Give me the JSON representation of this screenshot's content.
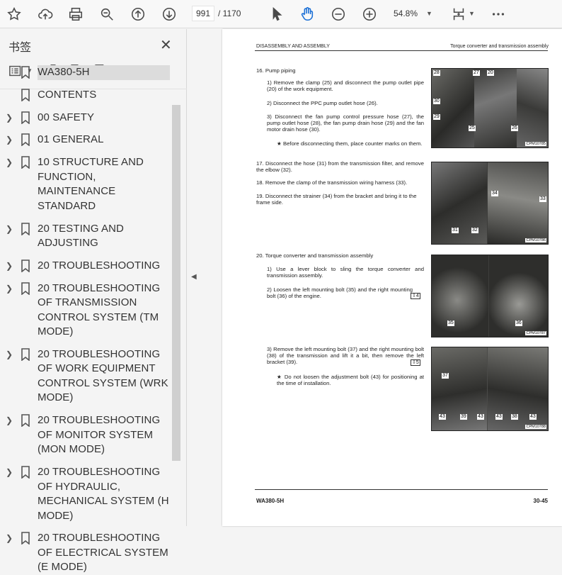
{
  "toolbar": {
    "page_current": "991",
    "page_total": "/ 1170",
    "zoom": "54.8%"
  },
  "sidebar": {
    "title": "书签",
    "items": [
      {
        "label": "WA380-5H",
        "expandable": false,
        "selected": true
      },
      {
        "label": "CONTENTS",
        "expandable": false
      },
      {
        "label": "00 SAFETY",
        "expandable": true
      },
      {
        "label": "01 GENERAL",
        "expandable": true
      },
      {
        "label": "10 STRUCTURE AND FUNCTION, MAINTENANCE STANDARD",
        "expandable": true
      },
      {
        "label": "20 TESTING AND ADJUSTING",
        "expandable": true
      },
      {
        "label": "20 TROUBLESHOOTING",
        "expandable": true
      },
      {
        "label": "20 TROUBLESHOOTING OF TRANSMISSION CONTROL SYSTEM (TM MODE)",
        "expandable": true
      },
      {
        "label": "20 TROUBLESHOOTING OF WORK EQUIPMENT CONTROL SYSTEM (WRK MODE)",
        "expandable": true
      },
      {
        "label": "20 TROUBLESHOOTING OF MONITOR SYSTEM (MON MODE)",
        "expandable": true
      },
      {
        "label": "20 TROUBLESHOOTING OF HYDRAULIC, MECHANICAL SYSTEM (H MODE)",
        "expandable": true
      },
      {
        "label": "20 TROUBLESHOOTING OF ELECTRICAL SYSTEM (E MODE)",
        "expandable": true
      }
    ]
  },
  "doc": {
    "header_left": "DISASSEMBLY AND ASSEMBLY",
    "header_right": "Torque converter and transmission assembly",
    "footer_left": "WA380-5H",
    "footer_right": "30-45",
    "s16": "16. Pump piping",
    "s16_1": "1)   Remove the clamp (25) and disconnect the pump outlet pipe (20) of the work equipment.",
    "s16_2": "2)   Disconnect the PPC pump outlet hose (26).",
    "s16_3": "3)   Disconnect the fan pump control pressure hose (27), the pump outlet hose (28), the fan pump drain hose (29) and the fan motor drain hose (30).",
    "s16_note": "★   Before disconnecting them, place counter marks on them.",
    "s17": "17. Disconnect the hose (31) from the transmission filter, and remove the elbow (32).",
    "s18": "18. Remove the clamp of the transmission wiring harness (33).",
    "s19": "19. Disconnect the strainer (34) from the bracket and bring it to the frame side.",
    "s20": "20. Torque converter and transmission assembly",
    "s20_1": "1)   Use a lever block to sling the torque converter and transmission assembly.",
    "s20_2": "2)   Loosen the left mounting bolt (35) and the right mounting bolt (36) of the engine.",
    "s20_2_ref": "4",
    "s20_3": "3)   Remove the left mounting bolt (37) and the right mounting bolt (38) of the transmission and lift it a bit, then remove the left bracket (39).",
    "s20_3_ref": "5",
    "s20_note": "★   Do not loosen the adjustment bolt (43) for positioning at the time of installation.",
    "photo1": {
      "code": "CPM10785",
      "labels": [
        "28",
        "27",
        "20",
        "30",
        "29",
        "25",
        "26"
      ]
    },
    "photo2": {
      "code": "CPM10786",
      "labels": [
        "34",
        "33",
        "31",
        "32"
      ]
    },
    "photo3": {
      "code": "CPM10787",
      "labels": [
        "35",
        "36"
      ]
    },
    "photo4": {
      "code": "CPM10788",
      "labels": [
        "37",
        "43",
        "39",
        "43",
        "43",
        "38",
        "43"
      ]
    }
  }
}
